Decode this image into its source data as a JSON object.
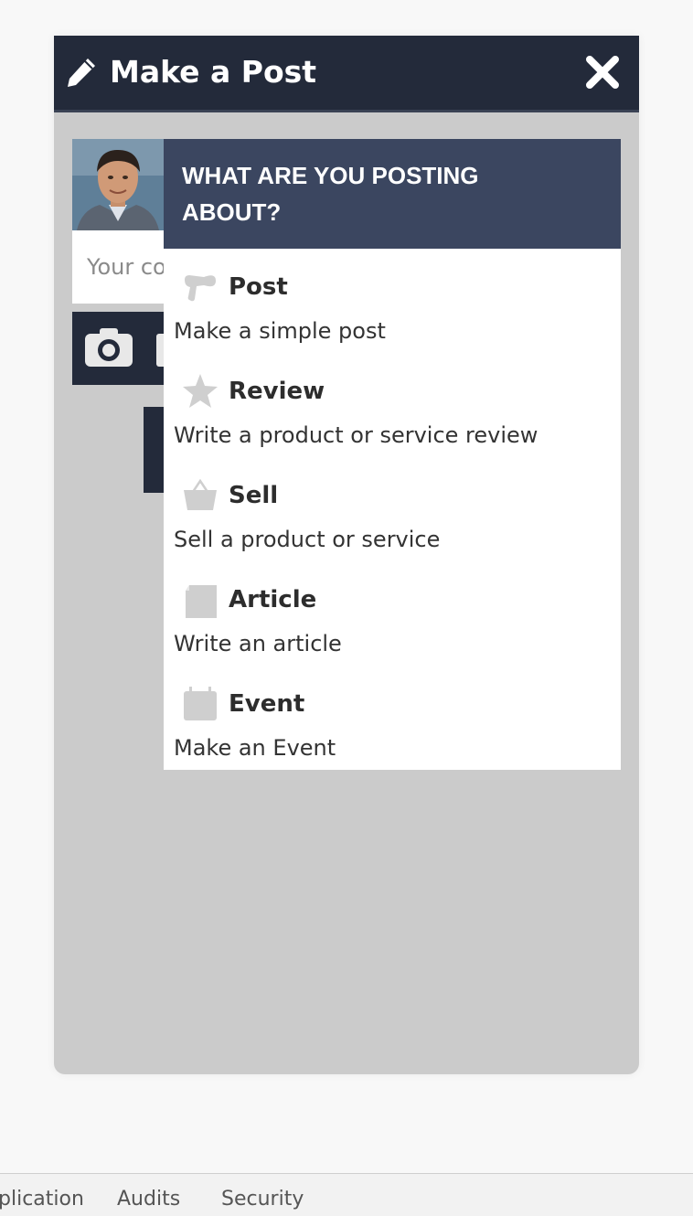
{
  "modal": {
    "title": "Make a Post",
    "composer": {
      "placeholder": "Your co"
    }
  },
  "dropdown": {
    "heading": "WHAT ARE YOU POSTING ABOUT?",
    "options": [
      {
        "label": "Post",
        "description": "Make a simple post",
        "icon": "megaphone-icon"
      },
      {
        "label": "Review",
        "description": "Write a product or service review",
        "icon": "star-icon"
      },
      {
        "label": "Sell",
        "description": "Sell a product or service",
        "icon": "basket-icon"
      },
      {
        "label": "Article",
        "description": "Write an article",
        "icon": "article-icon"
      },
      {
        "label": "Event",
        "description": "Make an Event",
        "icon": "calendar-icon"
      }
    ]
  },
  "devtools": {
    "tabs": [
      "plication",
      "Audits",
      "Security"
    ]
  },
  "colors": {
    "header": "#232a3a",
    "dropdown_header": "#3b4660",
    "modal_body": "#cbcbcb",
    "icon_gray": "#cfcfcf"
  }
}
